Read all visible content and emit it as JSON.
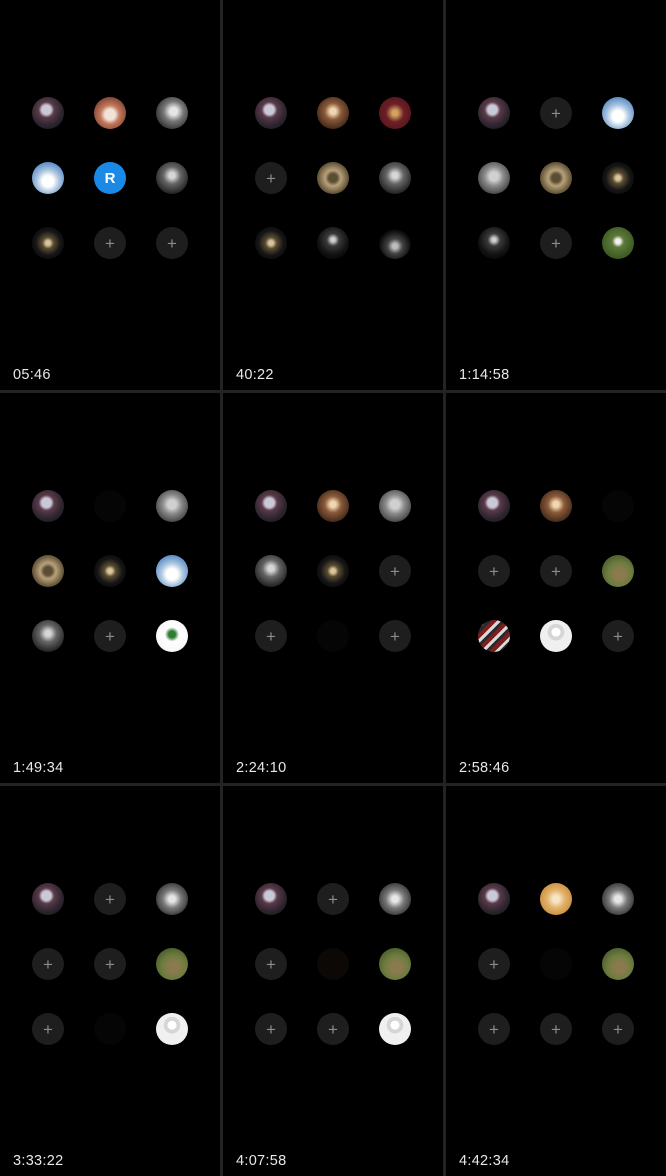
{
  "panels": [
    {
      "timestamp": "05:46",
      "slots": [
        {
          "kind": "avatar",
          "style": "av-cards",
          "name": "avatar-cards"
        },
        {
          "kind": "avatar",
          "style": "av-face-warm",
          "name": "avatar-face-warm"
        },
        {
          "kind": "avatar",
          "style": "av-bw-man",
          "name": "avatar-bw-man"
        },
        {
          "kind": "avatar",
          "style": "av-sky",
          "name": "avatar-sky"
        },
        {
          "kind": "avatar",
          "style": "av-R",
          "name": "avatar-initial-r",
          "text": "R"
        },
        {
          "kind": "avatar",
          "style": "av-portrait",
          "name": "avatar-portrait"
        },
        {
          "kind": "avatar",
          "style": "av-logo-gold",
          "name": "avatar-logo-gold"
        },
        {
          "kind": "add"
        },
        {
          "kind": "add"
        }
      ]
    },
    {
      "timestamp": "40:22",
      "slots": [
        {
          "kind": "avatar",
          "style": "av-cards",
          "name": "avatar-cards"
        },
        {
          "kind": "avatar",
          "style": "av-sign",
          "name": "avatar-sign"
        },
        {
          "kind": "avatar",
          "style": "av-palm",
          "name": "avatar-palm"
        },
        {
          "kind": "add"
        },
        {
          "kind": "avatar",
          "style": "av-gold-frame",
          "name": "avatar-gold-frame"
        },
        {
          "kind": "avatar",
          "style": "av-portrait",
          "name": "avatar-portrait"
        },
        {
          "kind": "avatar",
          "style": "av-logo-gold",
          "name": "avatar-logo-gold"
        },
        {
          "kind": "avatar",
          "style": "av-K",
          "name": "avatar-k-logo"
        },
        {
          "kind": "avatar",
          "style": "av-wolf",
          "name": "avatar-wolf-111"
        }
      ]
    },
    {
      "timestamp": "1:14:58",
      "slots": [
        {
          "kind": "avatar",
          "style": "av-cards",
          "name": "avatar-cards"
        },
        {
          "kind": "add"
        },
        {
          "kind": "avatar",
          "style": "av-sky",
          "name": "avatar-sky"
        },
        {
          "kind": "avatar",
          "style": "av-bw-dog",
          "name": "avatar-bw-dog"
        },
        {
          "kind": "avatar",
          "style": "av-gold-frame",
          "name": "avatar-gold-frame"
        },
        {
          "kind": "avatar",
          "style": "av-logo-gold",
          "name": "avatar-logo-gold"
        },
        {
          "kind": "avatar",
          "style": "av-K",
          "name": "avatar-k-logo"
        },
        {
          "kind": "add"
        },
        {
          "kind": "avatar",
          "style": "av-saudi-green",
          "name": "avatar-saudi-green"
        }
      ]
    },
    {
      "timestamp": "1:49:34",
      "slots": [
        {
          "kind": "avatar",
          "style": "av-cards",
          "name": "avatar-cards"
        },
        {
          "kind": "empty"
        },
        {
          "kind": "avatar",
          "style": "av-bw-dog",
          "name": "avatar-bw-dog"
        },
        {
          "kind": "avatar",
          "style": "av-gold-frame",
          "name": "avatar-gold-frame"
        },
        {
          "kind": "avatar",
          "style": "av-logo-gold",
          "name": "avatar-logo-gold"
        },
        {
          "kind": "avatar",
          "style": "av-sky",
          "name": "avatar-sky"
        },
        {
          "kind": "avatar",
          "style": "av-portrait",
          "name": "avatar-portrait"
        },
        {
          "kind": "add"
        },
        {
          "kind": "avatar",
          "style": "av-saudi-white",
          "name": "avatar-saudi-white"
        }
      ]
    },
    {
      "timestamp": "2:24:10",
      "slots": [
        {
          "kind": "avatar",
          "style": "av-cards",
          "name": "avatar-cards"
        },
        {
          "kind": "avatar",
          "style": "av-sign",
          "name": "avatar-sign"
        },
        {
          "kind": "avatar",
          "style": "av-bw-dog",
          "name": "avatar-bw-dog"
        },
        {
          "kind": "avatar",
          "style": "av-portrait",
          "name": "avatar-portrait"
        },
        {
          "kind": "avatar",
          "style": "av-logo-gold",
          "name": "avatar-logo-gold"
        },
        {
          "kind": "add"
        },
        {
          "kind": "add"
        },
        {
          "kind": "empty"
        },
        {
          "kind": "add"
        }
      ]
    },
    {
      "timestamp": "2:58:46",
      "slots": [
        {
          "kind": "avatar",
          "style": "av-cards",
          "name": "avatar-cards"
        },
        {
          "kind": "avatar",
          "style": "av-sign",
          "name": "avatar-sign"
        },
        {
          "kind": "empty"
        },
        {
          "kind": "add"
        },
        {
          "kind": "add"
        },
        {
          "kind": "avatar",
          "style": "av-landscape",
          "name": "avatar-landscape"
        },
        {
          "kind": "avatar",
          "style": "av-book",
          "name": "avatar-book"
        },
        {
          "kind": "avatar",
          "style": "av-person-white",
          "name": "avatar-person-white"
        },
        {
          "kind": "add"
        }
      ]
    },
    {
      "timestamp": "3:33:22",
      "slots": [
        {
          "kind": "avatar",
          "style": "av-cards",
          "name": "avatar-cards"
        },
        {
          "kind": "add"
        },
        {
          "kind": "avatar",
          "style": "av-face-blur",
          "name": "avatar-face-blur"
        },
        {
          "kind": "add"
        },
        {
          "kind": "add"
        },
        {
          "kind": "avatar",
          "style": "av-landscape",
          "name": "avatar-landscape"
        },
        {
          "kind": "add"
        },
        {
          "kind": "empty"
        },
        {
          "kind": "avatar",
          "style": "av-person-white",
          "name": "avatar-person-white"
        }
      ]
    },
    {
      "timestamp": "4:07:58",
      "slots": [
        {
          "kind": "avatar",
          "style": "av-cards",
          "name": "avatar-cards"
        },
        {
          "kind": "add"
        },
        {
          "kind": "avatar",
          "style": "av-face-blur",
          "name": "avatar-face-blur"
        },
        {
          "kind": "add"
        },
        {
          "kind": "dim"
        },
        {
          "kind": "avatar",
          "style": "av-landscape",
          "name": "avatar-landscape"
        },
        {
          "kind": "add"
        },
        {
          "kind": "add"
        },
        {
          "kind": "avatar",
          "style": "av-person-white",
          "name": "avatar-person-white"
        }
      ]
    },
    {
      "timestamp": "4:42:34",
      "slots": [
        {
          "kind": "avatar",
          "style": "av-cards",
          "name": "avatar-cards"
        },
        {
          "kind": "avatar",
          "style": "av-doge",
          "name": "avatar-doge"
        },
        {
          "kind": "avatar",
          "style": "av-face-blur",
          "name": "avatar-face-blur"
        },
        {
          "kind": "add"
        },
        {
          "kind": "empty"
        },
        {
          "kind": "avatar",
          "style": "av-landscape",
          "name": "avatar-landscape"
        },
        {
          "kind": "add"
        },
        {
          "kind": "add"
        },
        {
          "kind": "add"
        }
      ]
    }
  ],
  "add_glyph": "+"
}
